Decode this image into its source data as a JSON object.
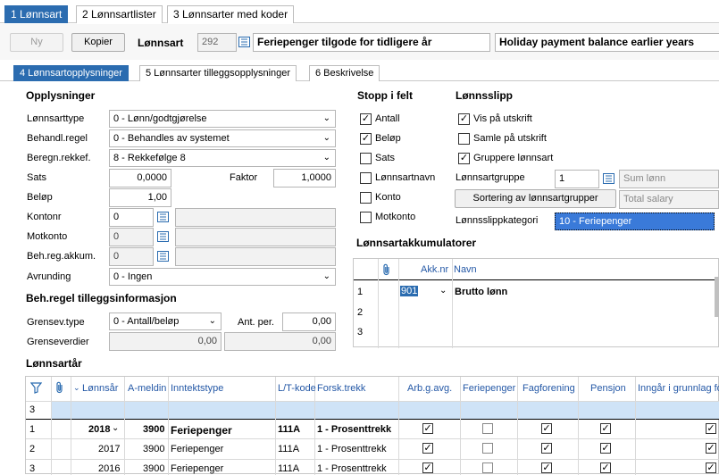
{
  "top_tabs": [
    "1 Lønnsart",
    "2 Lønnsartlister",
    "3 Lønnsarter med koder"
  ],
  "header": {
    "ny": "Ny",
    "kopier": "Kopier",
    "label": "Lønnsart",
    "number": "292",
    "name_no": "Feriepenger tilgode for tidligere år",
    "name_en": "Holiday payment balance earlier years"
  },
  "sub_tabs": [
    "4 Lønnsartopplysninger",
    "5 Lønnsarter tilleggsopplysninger",
    "6 Beskrivelse"
  ],
  "opplysninger": {
    "title": "Opplysninger",
    "lonnsarttype_label": "Lønnsarttype",
    "lonnsarttype": "0 - Lønn/godtgjørelse",
    "behandl_label": "Behandl.regel",
    "behandl": "0 - Behandles av systemet",
    "beregn_label": "Beregn.rekkef.",
    "beregn": "8 - Rekkefølge 8",
    "sats_label": "Sats",
    "sats": "0,0000",
    "faktor_label": "Faktor",
    "faktor": "1,0000",
    "belop_label": "Beløp",
    "belop": "1,00",
    "kontonr_label": "Kontonr",
    "kontonr": "0",
    "motkonto_label": "Motkonto",
    "motkonto": "0",
    "behreg_label": "Beh.reg.akkum.",
    "behreg": "0",
    "avrunding_label": "Avrunding",
    "avrunding": "0 - Ingen"
  },
  "tillegg": {
    "title": "Beh.regel tilleggsinformasjon",
    "grensev_label": "Grensev.type",
    "grensev": "0 - Antall/beløp",
    "antper_label": "Ant. per.",
    "antper": "0,00",
    "grenseverdier_label": "Grenseverdier",
    "gv1": "0,00",
    "gv2": "0,00"
  },
  "stopp": {
    "title": "Stopp i felt",
    "items": [
      {
        "label": "Antall",
        "checked": true
      },
      {
        "label": "Beløp",
        "checked": true
      },
      {
        "label": "Sats",
        "checked": false
      },
      {
        "label": "Lønnsartnavn",
        "checked": false
      },
      {
        "label": "Konto",
        "checked": false
      },
      {
        "label": "Motkonto",
        "checked": false
      }
    ]
  },
  "lonnsslipp": {
    "title": "Lønnsslipp",
    "vis": "Vis på utskrift",
    "samle": "Samle på utskrift",
    "grupp": "Gruppere lønnsart",
    "gruppe_label": "Lønnsartgruppe",
    "gruppe": "1",
    "sum": "Sum lønn",
    "sortering": "Sortering av lønnsartgrupper",
    "total": "Total salary",
    "kategori_label": "Lønnsslippkategori",
    "kategori": "10 - Feriepenger"
  },
  "akk": {
    "title": "Lønnsartakkumulatorer",
    "col_akk": "Akk.nr",
    "col_navn": "Navn",
    "rows": [
      {
        "n": "1",
        "akk": "901",
        "navn": "Brutto lønn"
      },
      {
        "n": "2",
        "akk": "",
        "navn": ""
      },
      {
        "n": "3",
        "akk": "",
        "navn": ""
      }
    ]
  },
  "lar": {
    "title": "Lønnsartår",
    "headers": [
      "Lønnsår",
      "A-meldin",
      "Inntektstype",
      "L/T-kode",
      "Forsk.trekk",
      "Arb.g.avg.",
      "Feriepenger",
      "Fagforening",
      "Pensjon",
      "Inngår i grunnlag fo"
    ],
    "filter_row": "3",
    "rows": [
      {
        "n": "1",
        "year": "2018",
        "am": "3900",
        "type": "Feriepenger",
        "lt": "111A",
        "fors": "1 - Prosenttrekk",
        "arb": true,
        "fer": false,
        "fag": true,
        "pen": true,
        "inn": true,
        "bold": true
      },
      {
        "n": "2",
        "year": "2017",
        "am": "3900",
        "type": "Feriepenger",
        "lt": "111A",
        "fors": "1 - Prosenttrekk",
        "arb": true,
        "fer": false,
        "fag": true,
        "pen": true,
        "inn": true,
        "bold": false
      },
      {
        "n": "3",
        "year": "2016",
        "am": "3900",
        "type": "Feriepenger",
        "lt": "111A",
        "fors": "1 - Prosenttrekk",
        "arb": true,
        "fer": false,
        "fag": true,
        "pen": true,
        "inn": true,
        "bold": false
      }
    ]
  }
}
